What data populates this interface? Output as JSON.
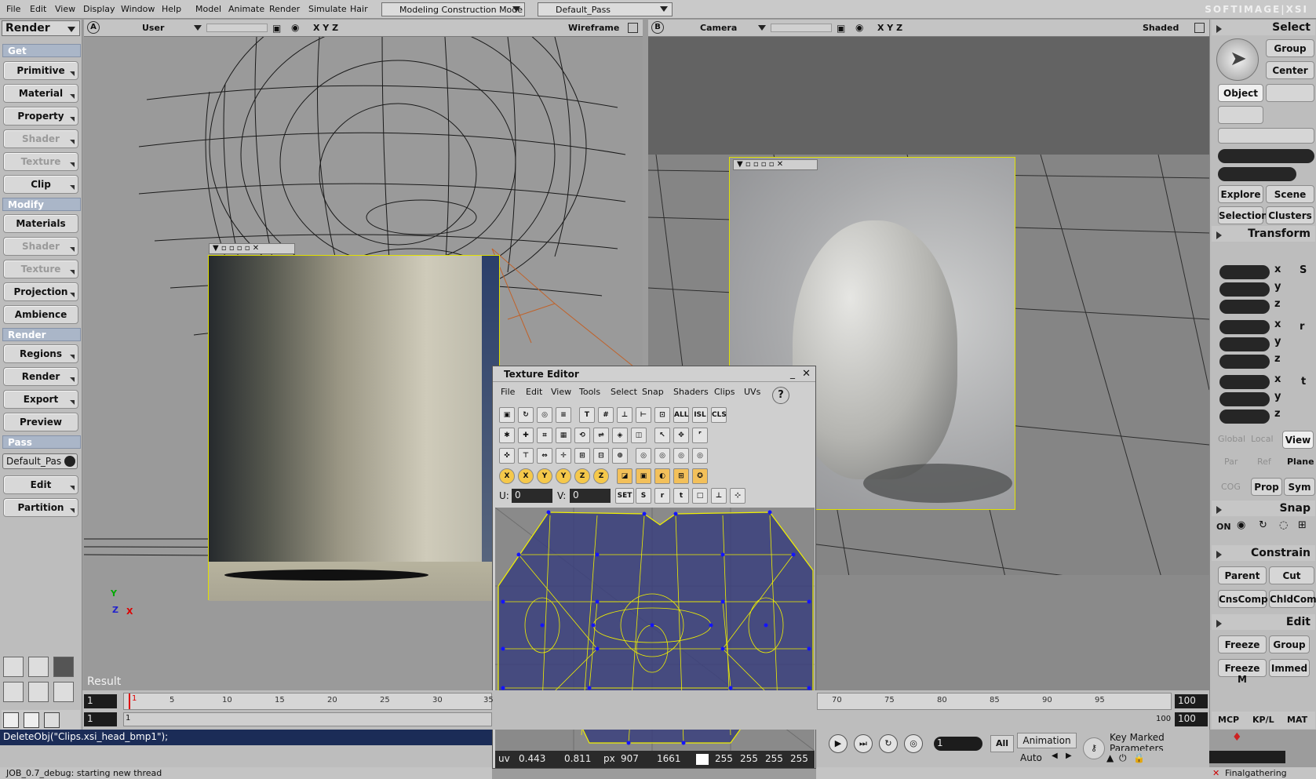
{
  "menubar": {
    "items": [
      "File",
      "Edit",
      "View",
      "Display",
      "Window",
      "Help",
      "Model",
      "Animate",
      "Render",
      "Simulate",
      "Hair"
    ],
    "mode": "Modeling Construction Mode",
    "pass": "Default_Pass",
    "brand": "SOFTIMAGE|XSI"
  },
  "left_panel": {
    "module": "Render",
    "sections": [
      {
        "header": "Get",
        "buttons": [
          {
            "label": "Primitive",
            "enabled": true
          },
          {
            "label": "Material",
            "enabled": true
          },
          {
            "label": "Property",
            "enabled": true
          },
          {
            "label": "Shader",
            "enabled": false
          },
          {
            "label": "Texture",
            "enabled": false
          },
          {
            "label": "Clip",
            "enabled": true
          }
        ]
      },
      {
        "header": "Modify",
        "buttons": [
          {
            "label": "Materials",
            "enabled": true
          },
          {
            "label": "Shader",
            "enabled": false
          },
          {
            "label": "Texture",
            "enabled": false
          },
          {
            "label": "Projection",
            "enabled": true
          },
          {
            "label": "Ambience",
            "enabled": true
          }
        ]
      },
      {
        "header": "Render",
        "buttons": [
          {
            "label": "Regions",
            "enabled": true
          },
          {
            "label": "Render",
            "enabled": true
          },
          {
            "label": "Export",
            "enabled": true
          },
          {
            "label": "Preview",
            "enabled": true
          }
        ]
      },
      {
        "header": "Pass",
        "buttons": [
          {
            "label": "Edit",
            "enabled": true
          },
          {
            "label": "Partition",
            "enabled": true
          }
        ]
      }
    ],
    "pass_select": "Default_Pas"
  },
  "viewport_a": {
    "letter": "A",
    "camera": "User",
    "xyz": "X Y Z",
    "mode": "Wireframe",
    "result_label": "Result",
    "axis_y": "Y",
    "axis_z": "Z",
    "axis_x": "X"
  },
  "viewport_b": {
    "letter": "B",
    "camera": "Camera",
    "xyz": "X Y Z",
    "mode": "Shaded"
  },
  "texture_editor": {
    "title": "Texture Editor",
    "menu": [
      "File",
      "Edit",
      "View",
      "Tools",
      "Select",
      "Snap",
      "Shaders",
      "Clips",
      "UVs"
    ],
    "help": "?",
    "row1_text_icons": [
      "T",
      "ALL",
      "ISL",
      "CLS"
    ],
    "u_label": "U:",
    "u_value": "0",
    "v_label": "V:",
    "v_value": "0",
    "set_label": "SET",
    "status": {
      "uv_label": "uv",
      "u": "0.443",
      "v": "0.811",
      "px_label": "px",
      "px_x": "907",
      "px_y": "1661",
      "r": "255",
      "g": "255",
      "b": "255",
      "a": "255"
    }
  },
  "right_panel": {
    "select": {
      "header": "Select",
      "group": "Group",
      "center": "Center",
      "object": "Object",
      "explore": "Explore",
      "scene": "Scene",
      "selection": "Selection",
      "clusters": "Clusters"
    },
    "transform": {
      "header": "Transform",
      "axes": [
        "x",
        "y",
        "z"
      ],
      "s_label": "S",
      "r_label": "r",
      "t_label": "t",
      "global": "Global",
      "local": "Local",
      "view": "View",
      "par": "Par",
      "ref": "Ref",
      "plane": "Plane",
      "cog": "COG",
      "prop": "Prop",
      "sym": "Sym"
    },
    "snap": {
      "header": "Snap",
      "on": "ON"
    },
    "constrain": {
      "header": "Constrain",
      "parent": "Parent",
      "cut": "Cut",
      "cnscomp": "CnsComp",
      "chldcomp": "ChldComp"
    },
    "edit": {
      "header": "Edit",
      "freeze": "Freeze",
      "group": "Group",
      "freeze_m": "Freeze M",
      "immed": "Immed"
    },
    "tabs": [
      "MCP",
      "KP/L",
      "MAT"
    ]
  },
  "timeline": {
    "start": "1",
    "end": "100",
    "start2": "1",
    "end2": "100",
    "current_marker": "1",
    "ticks_left": [
      "5",
      "10",
      "15",
      "20",
      "25",
      "30",
      "35"
    ],
    "ticks_right": [
      "70",
      "75",
      "80",
      "85",
      "90",
      "95"
    ],
    "end_label": "100",
    "frame_value": "1",
    "all_label": "All",
    "animation_label": "Animation",
    "auto_label": "Auto",
    "key_marked": "Key Marked Parameters"
  },
  "command_line": "DeleteObj(\"Clips.xsi_head_bmp1\");",
  "status_text": "JOB_0.7_debug: starting new thread",
  "finalgathering": "Finalgathering"
}
